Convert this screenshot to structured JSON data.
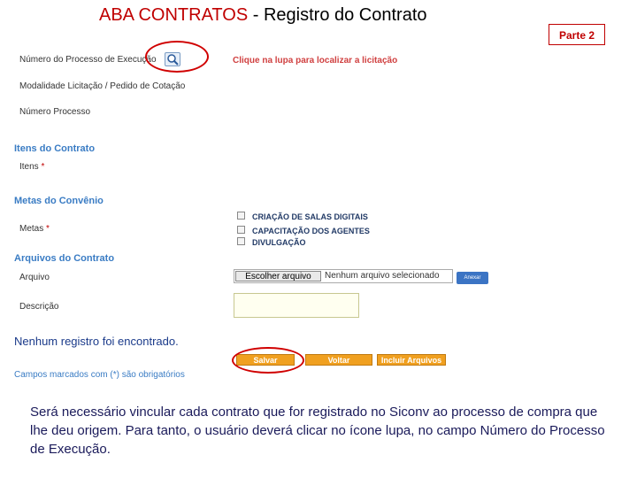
{
  "header": {
    "title_red": "ABA CONTRATOS ",
    "title_rest": " - Registro do Contrato",
    "part_badge": "Parte 2"
  },
  "form": {
    "processo_execucao_label": "Número do Processo de Execução",
    "lupa_hint": "Clique na lupa para localizar a licitação",
    "modalidade_label": "Modalidade Licitação / Pedido de Cotação",
    "numero_processo_label": "Número Processo",
    "itens_section": "Itens do Contrato",
    "itens_label": "Itens",
    "metas_section": "Metas do Convênio",
    "metas_label": "Metas",
    "required_mark": "*",
    "metas_options": [
      "CRIAÇÃO DE SALAS DIGITAIS",
      "CAPACITAÇÃO DOS AGENTES",
      "DIVULGAÇÃO"
    ],
    "arquivos_section": "Arquivos do Contrato",
    "arquivo_label": "Arquivo",
    "choose_file": "Escolher arquivo",
    "no_file": "Nenhum arquivo selecionado",
    "anexar": "Anexar",
    "descricao_label": "Descrição",
    "empty_message": "Nenhum registro foi encontrado.",
    "buttons": {
      "salvar": "Salvar",
      "voltar": "Voltar",
      "incluir": "Incluir Arquivos"
    },
    "required_note": "Campos marcados com (*) são obrigatórios"
  },
  "explanation": "Será necessário vincular cada contrato que for registrado no Siconv ao processo de compra que lhe deu origem. Para tanto, o usuário deverá clicar no ícone lupa, no campo Número do Processo de Execução.",
  "colors": {
    "accent_red": "#c00000",
    "section_blue": "#3a7cc4",
    "button_orange": "#f0a020"
  }
}
